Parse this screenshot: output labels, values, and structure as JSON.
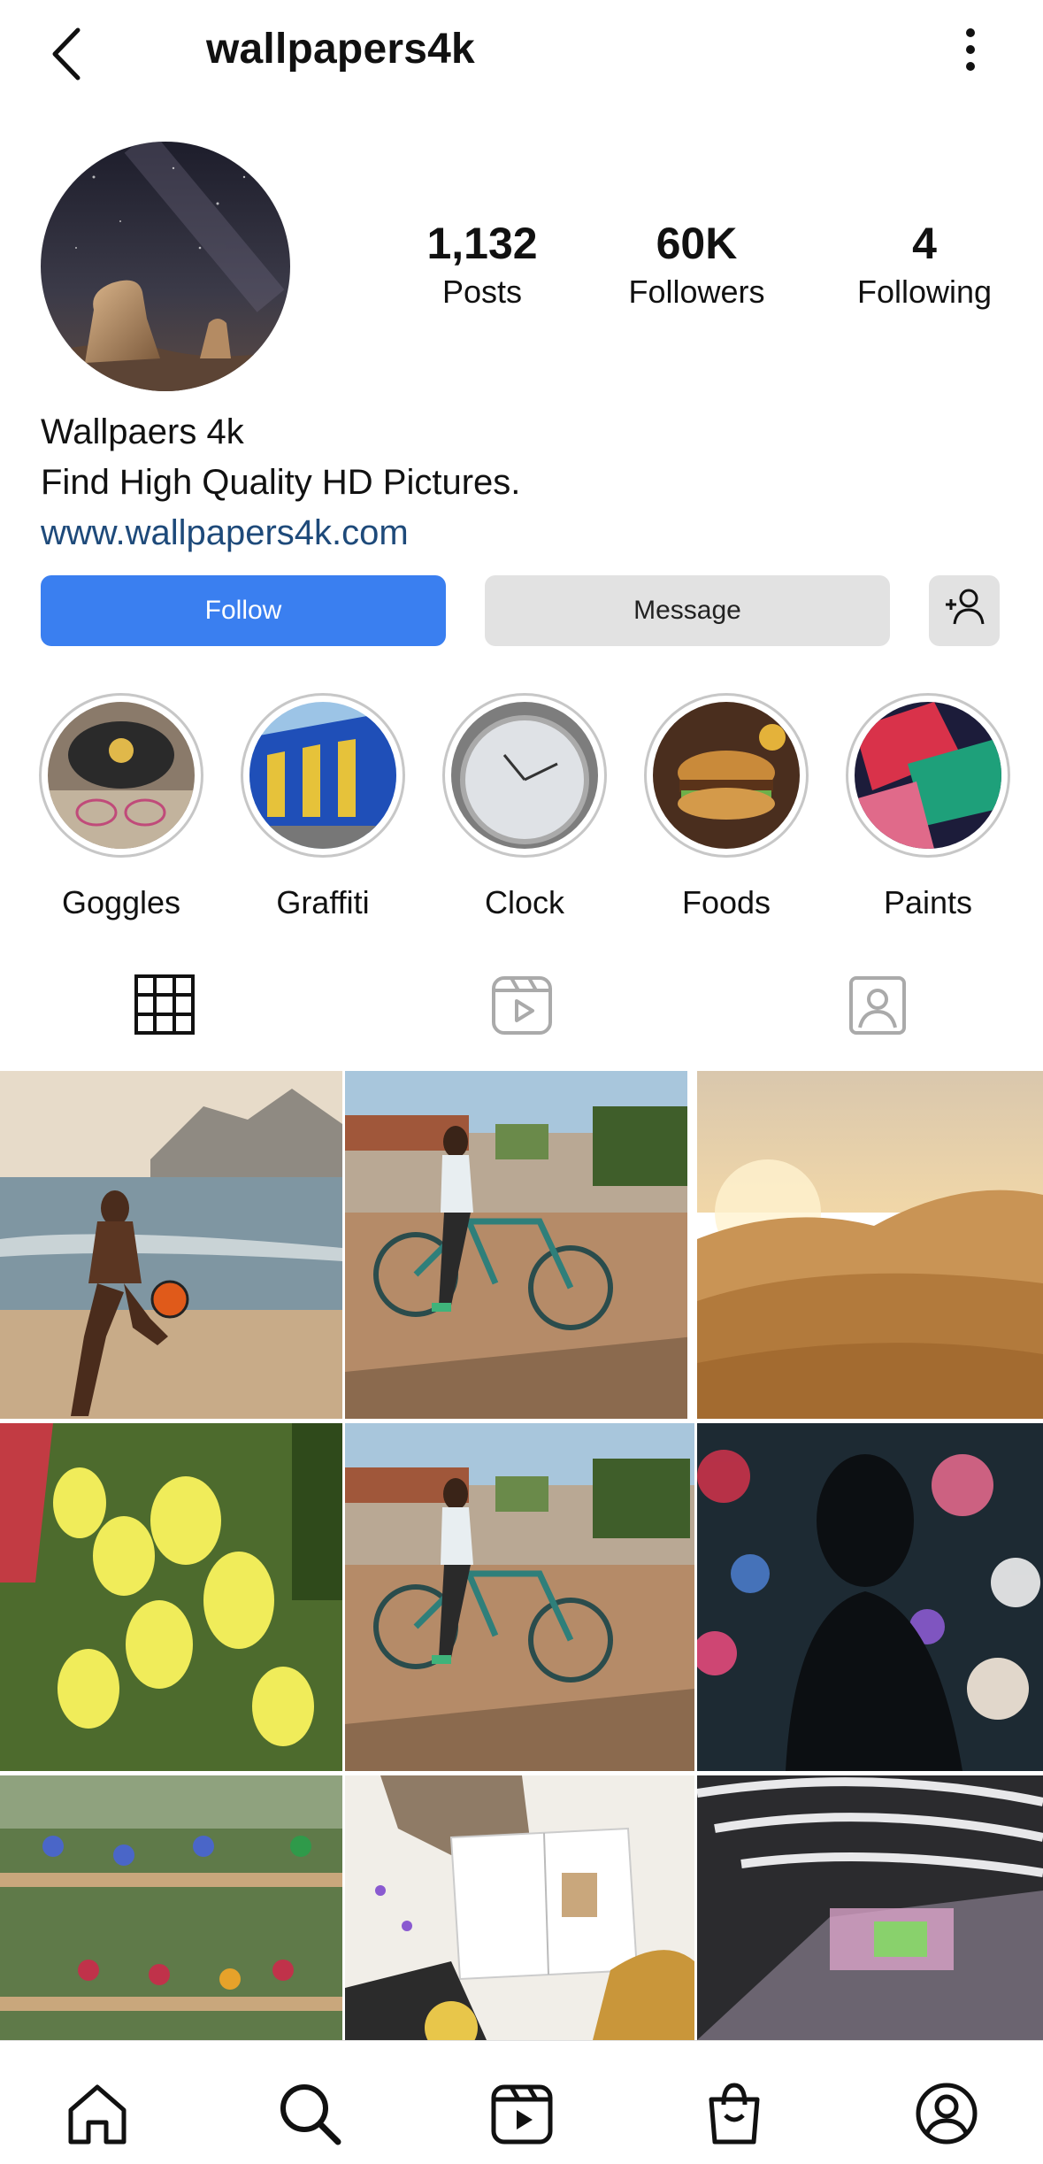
{
  "header": {
    "username": "wallpapers4k",
    "back_icon": "chevron-left-icon",
    "more_icon": "more-vertical-icon"
  },
  "profile": {
    "stats": {
      "posts_value": "1,132",
      "posts_label": "Posts",
      "followers_value": "60K",
      "followers_label": "Followers",
      "following_value": "4",
      "following_label": "Following"
    },
    "name": "Wallpaers 4k",
    "bio": "Find High Quality HD Pictures.",
    "website": "www.wallpapers4k.com"
  },
  "actions": {
    "follow_label": "Follow",
    "message_label": "Message",
    "add_icon": "add-person-icon"
  },
  "highlights": [
    {
      "label": "Goggles"
    },
    {
      "label": "Graffiti"
    },
    {
      "label": "Clock"
    },
    {
      "label": "Foods"
    },
    {
      "label": "Paints"
    }
  ],
  "tabs": [
    {
      "icon": "grid-icon",
      "active": true
    },
    {
      "icon": "reels-icon",
      "active": false
    },
    {
      "icon": "tagged-icon",
      "active": false
    }
  ],
  "colors": {
    "accent": "#3a7ff0",
    "link": "#1e4a7a",
    "secondary_button": "#e2e2e2"
  },
  "bottom_nav": [
    {
      "icon": "home-icon"
    },
    {
      "icon": "search-icon"
    },
    {
      "icon": "reels-icon"
    },
    {
      "icon": "shop-icon"
    },
    {
      "icon": "profile-icon"
    }
  ]
}
